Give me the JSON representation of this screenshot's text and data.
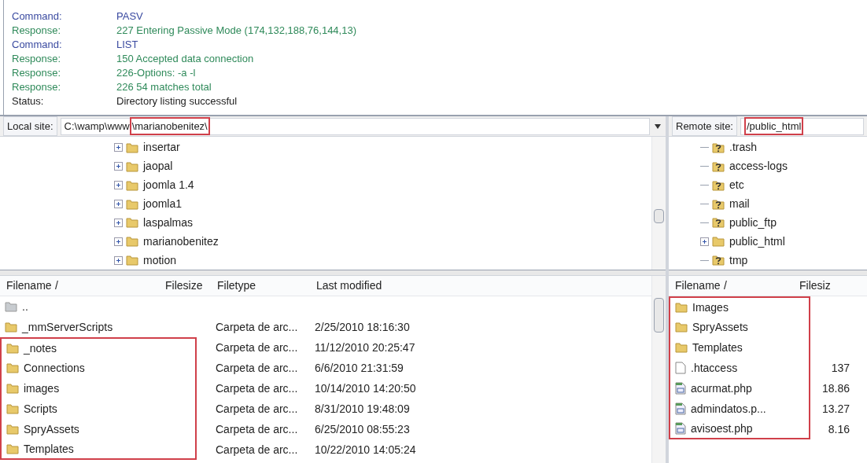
{
  "message_log": [
    {
      "kind": "command",
      "label": "Command:",
      "text": "PASV"
    },
    {
      "kind": "response",
      "label": "Response:",
      "text": "227 Entering Passive Mode (174,132,188,76,144,13)"
    },
    {
      "kind": "command",
      "label": "Command:",
      "text": "LIST"
    },
    {
      "kind": "response",
      "label": "Response:",
      "text": "150 Accepted data connection"
    },
    {
      "kind": "response",
      "label": "Response:",
      "text": "226-Options: -a -l"
    },
    {
      "kind": "response",
      "label": "Response:",
      "text": "226 54 matches total"
    },
    {
      "kind": "status",
      "label": "Status:",
      "text": "Directory listing successful"
    }
  ],
  "local_site": {
    "label": "Local site:",
    "path": [
      {
        "text": "C:\\wamp\\www",
        "highlighted": false
      },
      {
        "text": "\\marianobenitez\\",
        "highlighted": true
      }
    ],
    "tree": [
      {
        "name": "insertar",
        "kind": "folder",
        "expandable": true
      },
      {
        "name": "jaopal",
        "kind": "folder",
        "expandable": true
      },
      {
        "name": "joomla 1.4",
        "kind": "folder",
        "expandable": true
      },
      {
        "name": "joomla1",
        "kind": "folder",
        "expandable": true
      },
      {
        "name": "laspalmas",
        "kind": "folder",
        "expandable": true
      },
      {
        "name": "marianobenitez",
        "kind": "folder",
        "expandable": true
      },
      {
        "name": "motion",
        "kind": "folder",
        "expandable": true
      }
    ],
    "columns": [
      "Filename",
      "/",
      "Filesize",
      "Filetype",
      "Last modified"
    ],
    "files": [
      {
        "name": "..",
        "kind": "parent",
        "highlighted": false
      },
      {
        "name": "_mmServerScripts",
        "kind": "folder",
        "type": "Carpeta de arc...",
        "modified": "2/25/2010 18:16:30",
        "highlighted": false
      },
      {
        "name": "_notes",
        "kind": "folder",
        "type": "Carpeta de arc...",
        "modified": "11/12/2010 20:25:47",
        "highlighted": true
      },
      {
        "name": "Connections",
        "kind": "folder",
        "type": "Carpeta de arc...",
        "modified": "6/6/2010 21:31:59",
        "highlighted": true
      },
      {
        "name": "images",
        "kind": "folder",
        "type": "Carpeta de arc...",
        "modified": "10/14/2010 14:20:50",
        "highlighted": true
      },
      {
        "name": "Scripts",
        "kind": "folder",
        "type": "Carpeta de arc...",
        "modified": "8/31/2010 19:48:09",
        "highlighted": true
      },
      {
        "name": "SpryAssets",
        "kind": "folder",
        "type": "Carpeta de arc...",
        "modified": "6/25/2010 08:55:23",
        "highlighted": true
      },
      {
        "name": "Templates",
        "kind": "folder",
        "type": "Carpeta de arc...",
        "modified": "10/22/2010 14:05:24",
        "highlighted": true
      }
    ]
  },
  "remote_site": {
    "label": "Remote site:",
    "path": [
      {
        "text": "/public_html",
        "highlighted": true
      }
    ],
    "tree": [
      {
        "name": ".trash",
        "kind": "unknown",
        "expandable": false
      },
      {
        "name": "access-logs",
        "kind": "unknown",
        "expandable": false
      },
      {
        "name": "etc",
        "kind": "unknown",
        "expandable": false
      },
      {
        "name": "mail",
        "kind": "unknown",
        "expandable": false
      },
      {
        "name": "public_ftp",
        "kind": "unknown",
        "expandable": false
      },
      {
        "name": "public_html",
        "kind": "folder",
        "expandable": true
      },
      {
        "name": "tmp",
        "kind": "unknown",
        "expandable": false
      }
    ],
    "columns": [
      "Filename",
      "/",
      "Filesiz"
    ],
    "files": [
      {
        "name": "Images",
        "kind": "folder",
        "highlighted": true
      },
      {
        "name": "SpryAssets",
        "kind": "folder",
        "highlighted": true
      },
      {
        "name": "Templates",
        "kind": "folder",
        "highlighted": true
      },
      {
        "name": ".htaccess",
        "kind": "file",
        "size": "137",
        "highlighted": true
      },
      {
        "name": "acurmat.php",
        "kind": "php",
        "size": "18.86",
        "highlighted": true
      },
      {
        "name": "admindatos.p...",
        "kind": "php",
        "size": "13.27",
        "highlighted": true
      },
      {
        "name": "avisoest.php",
        "kind": "php",
        "size": "8.16",
        "highlighted": true
      }
    ]
  }
}
